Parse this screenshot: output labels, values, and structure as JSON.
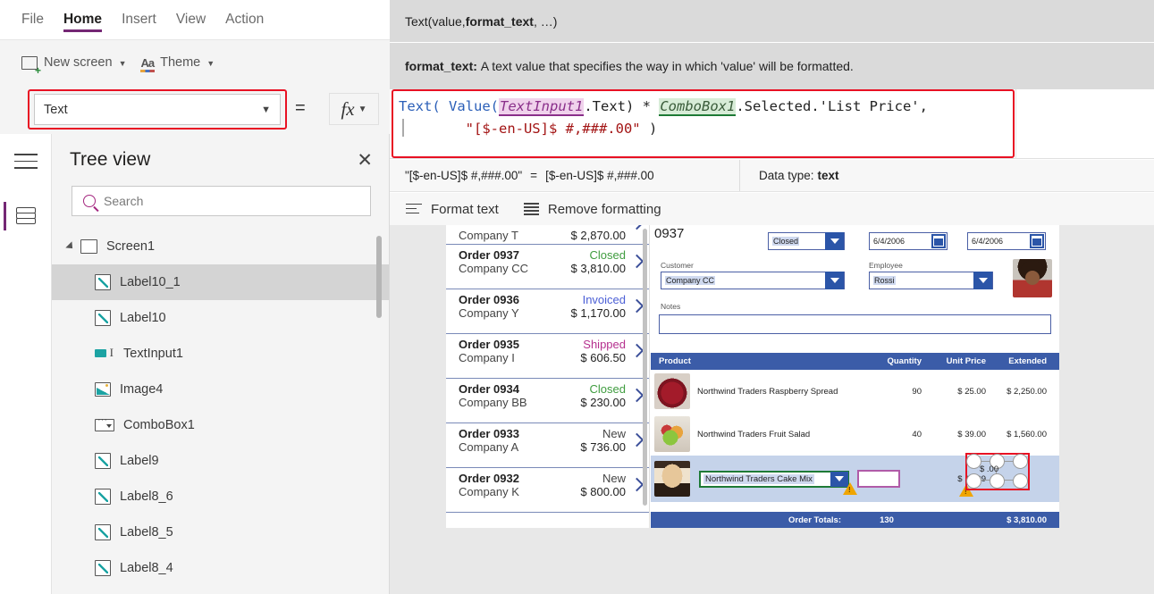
{
  "ribbon": {
    "tabs": [
      {
        "label": "File",
        "active": false
      },
      {
        "label": "Home",
        "active": true
      },
      {
        "label": "Insert",
        "active": false
      },
      {
        "label": "View",
        "active": false
      },
      {
        "label": "Action",
        "active": false
      }
    ],
    "new_screen_label": "New screen",
    "theme_label": "Theme",
    "font_value": "Open Sans"
  },
  "property_bar": {
    "selected_property": "Text",
    "equals": "=",
    "fx_label": "fx"
  },
  "intellisense": {
    "signature": "Text(value, format_text, …)",
    "signature_plain_1": "Text(value, ",
    "signature_bold": "format_text",
    "signature_plain_2": ", …)",
    "param_name": "format_text:",
    "param_description": "A text value that specifies the way in which 'value' will be formatted."
  },
  "formula": {
    "line1_tokens": [
      {
        "text": "Text( ",
        "style": "kw"
      },
      {
        "text": "Value(",
        "style": "kw"
      },
      {
        "text": "TextInput1",
        "style": "ctrl-pink"
      },
      {
        "text": ".Text) * ",
        "style": "plain"
      },
      {
        "text": "ComboBox1",
        "style": "ctrl-green"
      },
      {
        "text": ".Selected.'List Price',",
        "style": "plain"
      }
    ],
    "line2_indent": "        ",
    "line2_string": "\"[$-en-US]$ #,###.00\"",
    "line2_close": " )"
  },
  "result": {
    "expression": "\"[$-en-US]$ #,###.00\"",
    "equals": "=",
    "value": "[$-en-US]$ #,###.00",
    "data_type_label": "Data type:",
    "data_type_value": "text"
  },
  "format_toolbar": {
    "format_text": "Format text",
    "remove_formatting": "Remove formatting"
  },
  "tree_view": {
    "title": "Tree view",
    "search_placeholder": "Search",
    "root": {
      "label": "Screen1"
    },
    "items": [
      {
        "label": "Label10_1",
        "icon": "label-icon",
        "selected": true
      },
      {
        "label": "Label10",
        "icon": "label-icon",
        "selected": false
      },
      {
        "label": "TextInput1",
        "icon": "text-input-icon",
        "selected": false
      },
      {
        "label": "Image4",
        "icon": "image-icon",
        "selected": false
      },
      {
        "label": "ComboBox1",
        "icon": "combobox-icon",
        "selected": false
      },
      {
        "label": "Label9",
        "icon": "label-icon",
        "selected": false
      },
      {
        "label": "Label8_6",
        "icon": "label-icon",
        "selected": false
      },
      {
        "label": "Label8_5",
        "icon": "label-icon",
        "selected": false
      },
      {
        "label": "Label8_4",
        "icon": "label-icon",
        "selected": false
      }
    ]
  },
  "app": {
    "gallery": {
      "partial_top": {
        "company": "Company T",
        "amount": "$ 2,870.00"
      },
      "orders": [
        {
          "order": "Order 0937",
          "company": "Company CC",
          "status": "Closed",
          "status_color": "#3f9c3f",
          "amount": "$ 3,810.00"
        },
        {
          "order": "Order 0936",
          "company": "Company Y",
          "status": "Invoiced",
          "status_color": "#4b5fd6",
          "amount": "$ 1,170.00"
        },
        {
          "order": "Order 0935",
          "company": "Company I",
          "status": "Shipped",
          "status_color": "#b5308e",
          "amount": "$ 606.50"
        },
        {
          "order": "Order 0934",
          "company": "Company BB",
          "status": "Closed",
          "status_color": "#3f9c3f",
          "amount": "$ 230.00"
        },
        {
          "order": "Order 0933",
          "company": "Company A",
          "status": "New",
          "status_color": "#444444",
          "amount": "$ 736.00"
        },
        {
          "order": "Order 0932",
          "company": "Company K",
          "status": "New",
          "status_color": "#444444",
          "amount": "$ 800.00"
        }
      ]
    },
    "detail": {
      "order_number": "0937",
      "status_value": "Closed",
      "date1": "6/4/2006",
      "date2": "6/4/2006",
      "customer_label": "Customer",
      "customer_value": "Company CC",
      "employee_label": "Employee",
      "employee_value": "Rossi",
      "notes_label": "Notes",
      "notes_value": "",
      "table": {
        "headers": [
          "Product",
          "Quantity",
          "Unit Price",
          "Extended"
        ],
        "rows": [
          {
            "product": "Northwind Traders Raspberry Spread",
            "quantity": "90",
            "unit_price": "$ 25.00",
            "extended": "$ 2,250.00",
            "image": "raspberry-spread-thumbnail"
          },
          {
            "product": "Northwind Traders Fruit Salad",
            "quantity": "40",
            "unit_price": "$ 39.00",
            "extended": "$ 1,560.00",
            "image": "fruit-salad-thumbnail"
          }
        ],
        "edit_row": {
          "product": "Northwind Traders Cake Mix",
          "quantity": "",
          "unit_price": "$ 15.99",
          "extended": "$ .00",
          "image": "cake-mix-thumbnail"
        },
        "totals": {
          "label": "Order Totals:",
          "quantity": "130",
          "extended": "$ 3,810.00"
        }
      }
    }
  }
}
